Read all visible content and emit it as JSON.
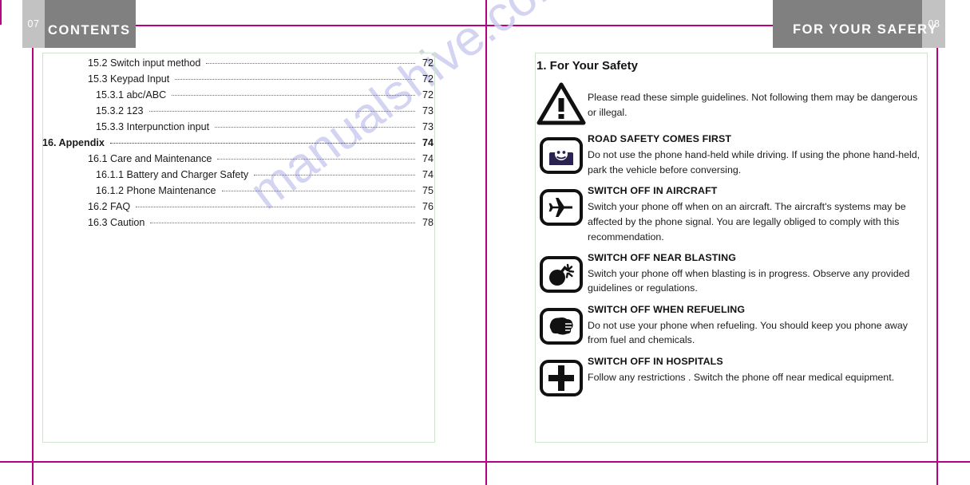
{
  "document": {
    "watermark": "manualshive.com",
    "accent_color": "#b5027f",
    "header_band_color": "#808080",
    "box_border_color": "#cfe3cf"
  },
  "left_page": {
    "page_number": "07",
    "header_title": "CONTENTS",
    "toc": [
      {
        "level": 2,
        "label": "15.2 Switch input method",
        "page": "72",
        "bold": false
      },
      {
        "level": 2,
        "label": "15.3 Keypad Input",
        "page": "72",
        "bold": false
      },
      {
        "level": 3,
        "label": "15.3.1  abc/ABC",
        "page": "72",
        "bold": false
      },
      {
        "level": 3,
        "label": "15.3.2 123",
        "page": "73",
        "bold": false
      },
      {
        "level": 3,
        "label": "15.3.3 Interpunction input",
        "page": "73",
        "bold": false
      },
      {
        "level": 0,
        "label": "16. Appendix",
        "page": "74",
        "bold": true
      },
      {
        "level": 2,
        "label": "16.1 Care and Maintenance",
        "page": "74",
        "bold": false
      },
      {
        "level": 3,
        "label": "16.1.1 Battery and Charger Safety",
        "page": "74",
        "bold": false
      },
      {
        "level": 3,
        "label": "16.1.2 Phone Maintenance",
        "page": "75",
        "bold": false
      },
      {
        "level": 2,
        "label": "16.2 FAQ",
        "page": "76",
        "bold": false
      },
      {
        "level": 2,
        "label": "16.3 Caution",
        "page": "78",
        "bold": false
      }
    ]
  },
  "right_page": {
    "page_number": "08",
    "header_title": "FOR YOUR SAFERY",
    "chapter_title": "1. For Your Safety",
    "items": [
      {
        "icon": "warning-triangle-icon",
        "heading": "",
        "body": "Please read these simple guidelines. Not following them may be dangerous or illegal."
      },
      {
        "icon": "car-driving-icon",
        "heading": "ROAD SAFETY COMES FIRST",
        "body": "Do not use the phone hand-held while driving. If using the phone hand-held, park the vehicle before conversing."
      },
      {
        "icon": "airplane-icon",
        "heading": "SWITCH OFF IN AIRCRAFT",
        "body": "Switch your phone off when on an aircraft. The aircraft's systems may be affected by the phone signal. You are legally obliged to comply with this recommendation."
      },
      {
        "icon": "bomb-blasting-icon",
        "heading": "SWITCH OFF NEAR BLASTING",
        "body": "Switch your phone off when blasting is in progress. Observe any provided guidelines or regulations."
      },
      {
        "icon": "fuel-pump-icon",
        "heading": "SWITCH OFF WHEN REFUELING",
        "body": "Do not use your phone when refueling. You should keep you phone away from fuel and chemicals."
      },
      {
        "icon": "medical-cross-icon",
        "heading": "SWITCH OFF IN HOSPITALS",
        "body": "Follow any restrictions . Switch the phone off near medical equipment."
      }
    ]
  }
}
